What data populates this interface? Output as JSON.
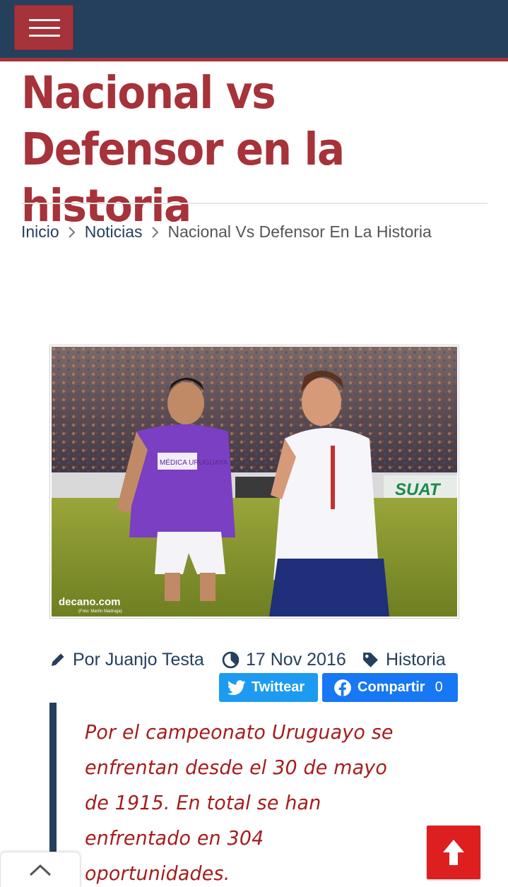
{
  "header": {
    "menu_icon": "hamburger-icon",
    "accent": "#a6323a",
    "bar_color": "#24405d"
  },
  "article": {
    "title": "Nacional vs Defensor en la historia",
    "author": "Por Juanjo Testa",
    "date": "17 Nov 2016",
    "category": "Historia",
    "lead": "Por el campeonato Uruguayo se enfrentan desde el 30 de mayo de 1915. En total se han enfrentado en 304 oportunidades."
  },
  "breadcrumb": {
    "items": [
      {
        "label": "Inicio"
      },
      {
        "label": "Noticias"
      },
      {
        "label": "Nacional Vs Defensor En La Historia"
      }
    ]
  },
  "hero": {
    "watermark": "decano.com",
    "photo_credit": "(Foto: Martín Madruga)",
    "jersey_text": "MÉDICA URUGUAYA",
    "board_text": "SUAT"
  },
  "share": {
    "twitter_label": "Twittear",
    "facebook_label": "Compartir",
    "facebook_count": "0",
    "twitter_color": "#1d9bf0",
    "facebook_color": "#1877f2"
  },
  "icons": {
    "author": "pencil-icon",
    "date": "clock-icon",
    "category": "tag-icon",
    "scroll_top": "arrow-up-icon",
    "collapse": "chevron-up-icon"
  }
}
